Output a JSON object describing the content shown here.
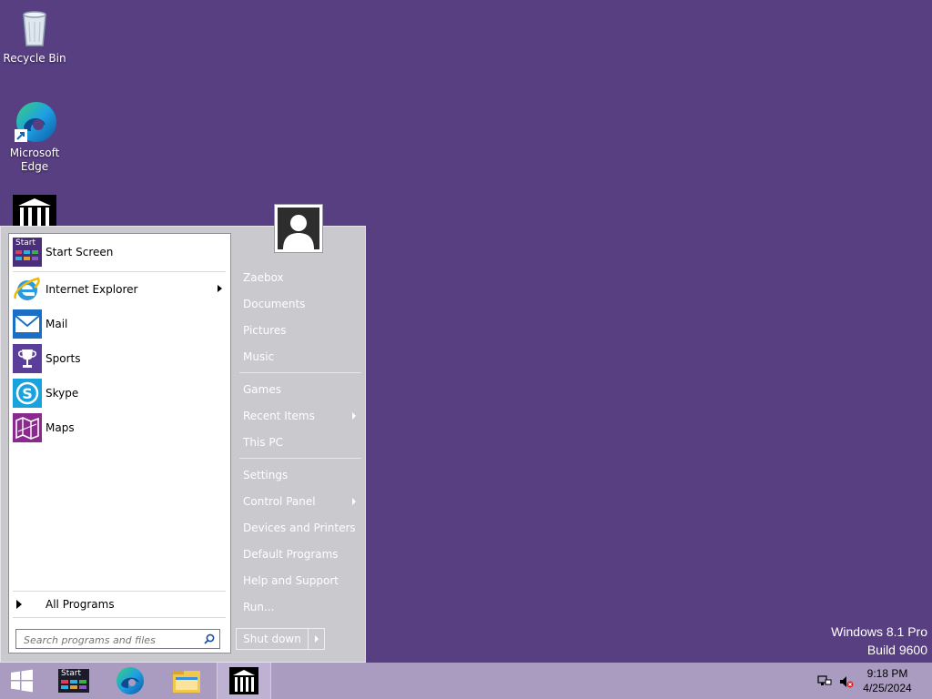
{
  "desktop": {
    "icons": [
      {
        "label": "Recycle Bin"
      },
      {
        "label": "Microsoft Edge"
      },
      {
        "label": ""
      }
    ]
  },
  "start_menu": {
    "pinned": [
      {
        "label": "Start Screen",
        "icon": "start-screen-icon"
      },
      {
        "label": "Internet Explorer",
        "icon": "internet-explorer-icon",
        "submenu": true
      },
      {
        "label": "Mail",
        "icon": "mail-icon"
      },
      {
        "label": "Sports",
        "icon": "trophy-icon"
      },
      {
        "label": "Skype",
        "icon": "skype-icon"
      },
      {
        "label": "Maps",
        "icon": "maps-icon"
      }
    ],
    "start_badge": "Start",
    "all_programs": "All Programs",
    "search_placeholder": "Search programs and files",
    "right_items": [
      {
        "label": "Zaebox"
      },
      {
        "label": "Documents"
      },
      {
        "label": "Pictures"
      },
      {
        "label": "Music"
      },
      {
        "label": "Games"
      },
      {
        "label": "Recent Items",
        "submenu": true
      },
      {
        "label": "This PC"
      },
      {
        "label": "Settings"
      },
      {
        "label": "Control Panel",
        "submenu": true
      },
      {
        "label": "Devices and Printers"
      },
      {
        "label": "Default Programs"
      },
      {
        "label": "Help and Support"
      },
      {
        "label": "Run..."
      }
    ],
    "shutdown_label": "Shut down"
  },
  "watermark": {
    "line1": "Windows 8.1 Pro",
    "line2": "Build 9600"
  },
  "taskbar": {
    "start_badge": "Start",
    "clock_time": "9:18 PM",
    "clock_date": "4/25/2024"
  },
  "colors": {
    "desktop": "#583f82",
    "taskbar": "#a99cc0",
    "menu_bg": "#c9c9ce"
  }
}
